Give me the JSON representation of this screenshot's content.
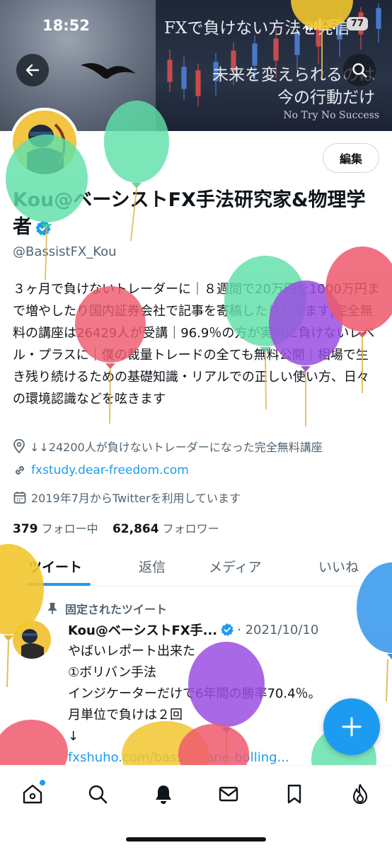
{
  "status_bar": {
    "time": "18:52",
    "battery": "77"
  },
  "banner": {
    "line1": "FXで負けない方法を発信",
    "line2": "未来を変えられるのは",
    "line3": "今の行動だけ",
    "line4": "No Try No Success"
  },
  "profile": {
    "name": "Kou@ベーシストFX手法研究家&物理学者",
    "handle": "@BassistFX_Kou",
    "edit_label": "編集",
    "bio": "３ヶ月で負けないトレーダーに｜８週間で20万円を1000万円まで増やしたり国内証券会社で記事を寄稿したりしてます|完全無料の講座は26429人が受講｜96.9％の方が実際に負けないレベル・プラスに｜僕の裁量トレードの全ても無料公開｜相場で生き残り続けるための基礎知識・リアルでの正しい使い方、日々の環境認識などを呟きます",
    "location": "↓↓24200人が負けないトレーダーになった完全無料講座",
    "link": "fxstudy.dear-freedom.com",
    "joined": "2019年7月からTwitterを利用しています",
    "following_count": "379",
    "following_label": "フォロー中",
    "followers_count": "62,864",
    "followers_label": "フォロワー"
  },
  "tabs": [
    {
      "label": "ツイート",
      "active": true
    },
    {
      "label": "返信",
      "active": false
    },
    {
      "label": "メディア",
      "active": false
    },
    {
      "label": "いいね",
      "active": false
    }
  ],
  "tweet": {
    "pinned_label": "固定されたツイート",
    "author": "Kou@ベーシストFX手...",
    "date": "2021/10/10",
    "lines": [
      "やばいレポート出来た",
      "①ボリバン手法",
      "インジケーターだけで6年間の勝率70.4％。",
      "月単位で負けは２回",
      "↓"
    ],
    "link": "fxshuho.com/bassisteane-bolling..."
  },
  "icons": {
    "back": "arrow-left-icon",
    "search": "search-icon",
    "compose": "plus-icon",
    "location": "location-pin-icon",
    "link": "link-icon",
    "calendar": "calendar-icon",
    "pin": "pin-icon",
    "verified": "verified-badge-icon",
    "nav": [
      "home-icon",
      "search-icon",
      "bell-icon",
      "mail-icon",
      "bookmark-icon",
      "flame-icon"
    ]
  },
  "colors": {
    "accent": "#1d9bf0",
    "text": "#0f1419",
    "muted": "#536471"
  }
}
